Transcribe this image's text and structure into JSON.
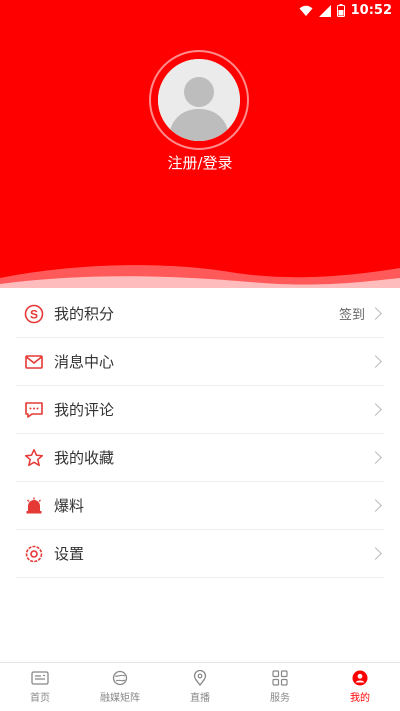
{
  "status_bar": {
    "time": "10:52"
  },
  "profile": {
    "login_label": "注册/登录"
  },
  "menu": [
    {
      "label": "我的积分",
      "right_text": "签到",
      "icon": "points-icon"
    },
    {
      "label": "消息中心",
      "right_text": "",
      "icon": "message-icon"
    },
    {
      "label": "我的评论",
      "right_text": "",
      "icon": "comment-icon"
    },
    {
      "label": "我的收藏",
      "right_text": "",
      "icon": "star-icon"
    },
    {
      "label": "爆料",
      "right_text": "",
      "icon": "alarm-icon"
    },
    {
      "label": "设置",
      "right_text": "",
      "icon": "gear-icon"
    }
  ],
  "tabs": [
    {
      "label": "首页",
      "icon": "newspaper-icon"
    },
    {
      "label": "融媒矩阵",
      "icon": "globe-icon"
    },
    {
      "label": "直播",
      "icon": "location-icon"
    },
    {
      "label": "服务",
      "icon": "grid-icon"
    },
    {
      "label": "我的",
      "icon": "user-icon"
    }
  ],
  "colors": {
    "brand": "#ff0000",
    "text": "#333333",
    "muted": "#888888"
  }
}
